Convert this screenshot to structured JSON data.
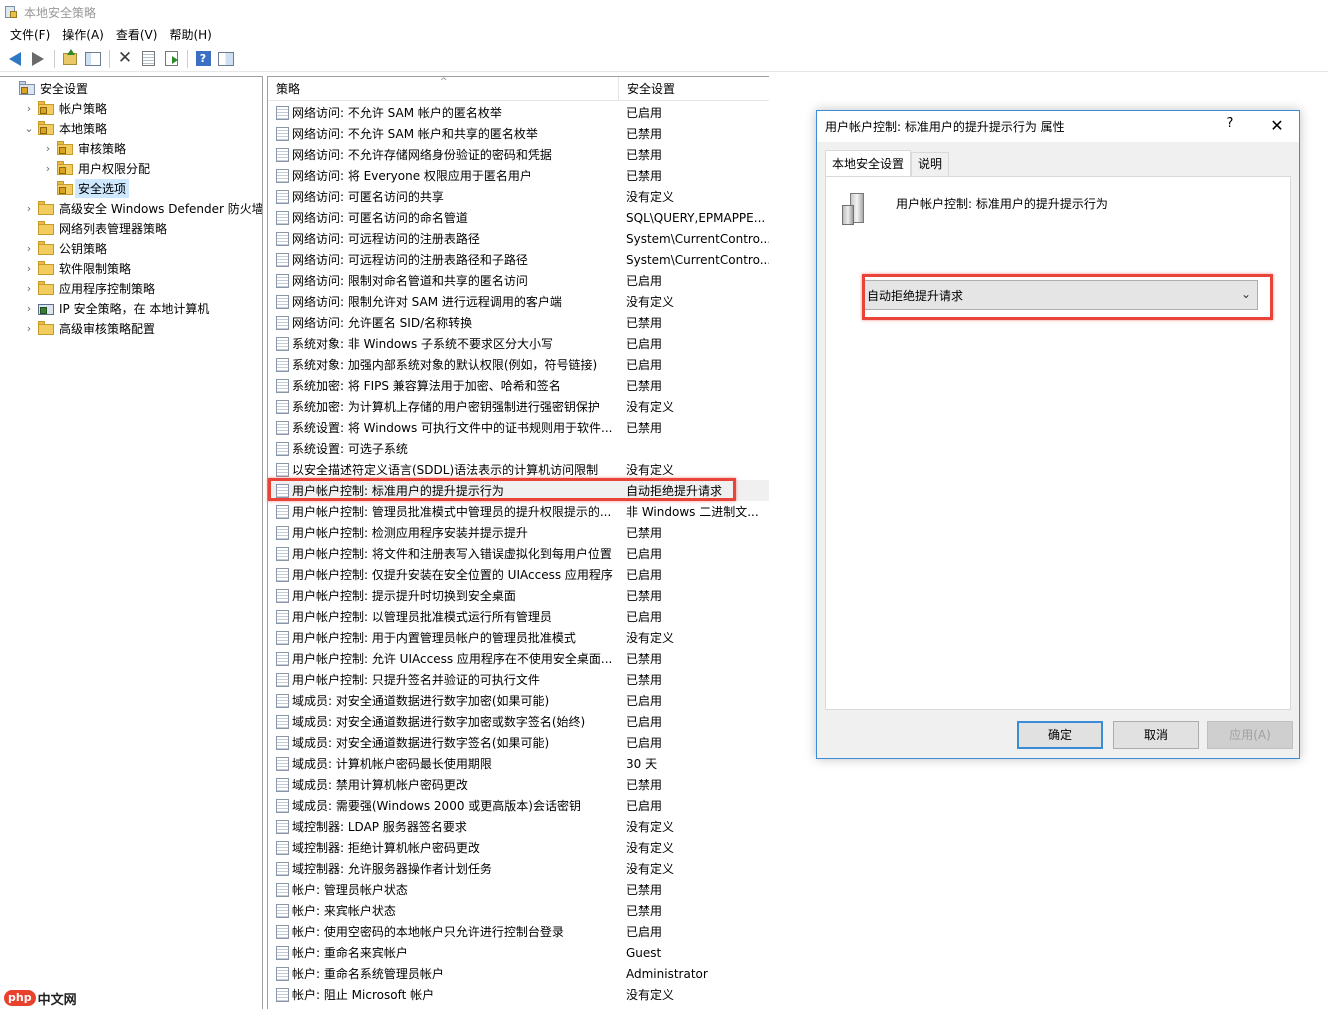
{
  "window": {
    "title": "本地安全策略"
  },
  "menu": [
    "文件(F)",
    "操作(A)",
    "查看(V)",
    "帮助(H)"
  ],
  "toolbar": [
    "back-icon",
    "forward-icon",
    "up-folder-icon",
    "show-tree-icon",
    "delete-icon",
    "properties-icon",
    "export-list-icon",
    "help-icon",
    "action-pane-icon"
  ],
  "tree": [
    {
      "label": "安全设置",
      "expander": "",
      "depth": 0,
      "folder": "root"
    },
    {
      "label": "帐户策略",
      "expander": "›",
      "depth": 1,
      "folder": "lock"
    },
    {
      "label": "本地策略",
      "expander": "⌄",
      "depth": 1,
      "folder": "lock"
    },
    {
      "label": "审核策略",
      "expander": "›",
      "depth": 2,
      "folder": "lock"
    },
    {
      "label": "用户权限分配",
      "expander": "›",
      "depth": 2,
      "folder": "lock"
    },
    {
      "label": "安全选项",
      "expander": "",
      "depth": 2,
      "folder": "lock",
      "selected": true
    },
    {
      "label": "高级安全 Windows Defender 防火墙",
      "expander": "›",
      "depth": 1,
      "folder": "plain"
    },
    {
      "label": "网络列表管理器策略",
      "expander": "",
      "depth": 1,
      "folder": "plain"
    },
    {
      "label": "公钥策略",
      "expander": "›",
      "depth": 1,
      "folder": "plain"
    },
    {
      "label": "软件限制策略",
      "expander": "›",
      "depth": 1,
      "folder": "plain"
    },
    {
      "label": "应用程序控制策略",
      "expander": "›",
      "depth": 1,
      "folder": "plain"
    },
    {
      "label": "IP 安全策略，在 本地计算机",
      "expander": "›",
      "depth": 1,
      "folder": "ip"
    },
    {
      "label": "高级审核策略配置",
      "expander": "›",
      "depth": 1,
      "folder": "plain"
    }
  ],
  "list": {
    "col_policy": "策略",
    "col_setting": "安全设置",
    "rows": [
      {
        "policy": "网络访问: 不允许 SAM 帐户的匿名枚举",
        "setting": "已启用"
      },
      {
        "policy": "网络访问: 不允许 SAM 帐户和共享的匿名枚举",
        "setting": "已禁用"
      },
      {
        "policy": "网络访问: 不允许存储网络身份验证的密码和凭据",
        "setting": "已禁用"
      },
      {
        "policy": "网络访问: 将 Everyone 权限应用于匿名用户",
        "setting": "已禁用"
      },
      {
        "policy": "网络访问: 可匿名访问的共享",
        "setting": "没有定义"
      },
      {
        "policy": "网络访问: 可匿名访问的命名管道",
        "setting": "SQL\\QUERY,EPMAPPE..."
      },
      {
        "policy": "网络访问: 可远程访问的注册表路径",
        "setting": "System\\CurrentContro..."
      },
      {
        "policy": "网络访问: 可远程访问的注册表路径和子路径",
        "setting": "System\\CurrentContro..."
      },
      {
        "policy": "网络访问: 限制对命名管道和共享的匿名访问",
        "setting": "已启用"
      },
      {
        "policy": "网络访问: 限制允许对 SAM 进行远程调用的客户端",
        "setting": "没有定义"
      },
      {
        "policy": "网络访问: 允许匿名 SID/名称转换",
        "setting": "已禁用"
      },
      {
        "policy": "系统对象: 非 Windows 子系统不要求区分大小写",
        "setting": "已启用"
      },
      {
        "policy": "系统对象: 加强内部系统对象的默认权限(例如，符号链接)",
        "setting": "已启用"
      },
      {
        "policy": "系统加密: 将 FIPS 兼容算法用于加密、哈希和签名",
        "setting": "已禁用"
      },
      {
        "policy": "系统加密: 为计算机上存储的用户密钥强制进行强密钥保护",
        "setting": "没有定义"
      },
      {
        "policy": "系统设置: 将 Windows 可执行文件中的证书规则用于软件...",
        "setting": "已禁用"
      },
      {
        "policy": "系统设置: 可选子系统",
        "setting": ""
      },
      {
        "policy": "以安全描述符定义语言(SDDL)语法表示的计算机访问限制",
        "setting": "没有定义"
      },
      {
        "policy": "用户帐户控制: 标准用户的提升提示行为",
        "setting": "自动拒绝提升请求",
        "active": true
      },
      {
        "policy": "用户帐户控制: 管理员批准模式中管理员的提升权限提示的...",
        "setting": "非 Windows 二进制文..."
      },
      {
        "policy": "用户帐户控制: 检测应用程序安装并提示提升",
        "setting": "已禁用"
      },
      {
        "policy": "用户帐户控制: 将文件和注册表写入错误虚拟化到每用户位置",
        "setting": "已启用"
      },
      {
        "policy": "用户帐户控制: 仅提升安装在安全位置的 UIAccess 应用程序",
        "setting": "已启用"
      },
      {
        "policy": "用户帐户控制: 提示提升时切换到安全桌面",
        "setting": "已禁用"
      },
      {
        "policy": "用户帐户控制: 以管理员批准模式运行所有管理员",
        "setting": "已启用"
      },
      {
        "policy": "用户帐户控制: 用于内置管理员帐户的管理员批准模式",
        "setting": "没有定义"
      },
      {
        "policy": "用户帐户控制: 允许 UIAccess 应用程序在不使用安全桌面...",
        "setting": "已禁用"
      },
      {
        "policy": "用户帐户控制: 只提升签名并验证的可执行文件",
        "setting": "已禁用"
      },
      {
        "policy": "域成员: 对安全通道数据进行数字加密(如果可能)",
        "setting": "已启用"
      },
      {
        "policy": "域成员: 对安全通道数据进行数字加密或数字签名(始终)",
        "setting": "已启用"
      },
      {
        "policy": "域成员: 对安全通道数据进行数字签名(如果可能)",
        "setting": "已启用"
      },
      {
        "policy": "域成员: 计算机帐户密码最长使用期限",
        "setting": "30 天"
      },
      {
        "policy": "域成员: 禁用计算机帐户密码更改",
        "setting": "已禁用"
      },
      {
        "policy": "域成员: 需要强(Windows 2000 或更高版本)会话密钥",
        "setting": "已启用"
      },
      {
        "policy": "域控制器: LDAP 服务器签名要求",
        "setting": "没有定义"
      },
      {
        "policy": "域控制器: 拒绝计算机帐户密码更改",
        "setting": "没有定义"
      },
      {
        "policy": "域控制器: 允许服务器操作者计划任务",
        "setting": "没有定义"
      },
      {
        "policy": "帐户: 管理员帐户状态",
        "setting": "已禁用"
      },
      {
        "policy": "帐户: 来宾帐户状态",
        "setting": "已禁用"
      },
      {
        "policy": "帐户: 使用空密码的本地帐户只允许进行控制台登录",
        "setting": "已启用"
      },
      {
        "policy": "帐户: 重命名来宾帐户",
        "setting": "Guest"
      },
      {
        "policy": "帐户: 重命名系统管理员帐户",
        "setting": "Administrator"
      },
      {
        "policy": "帐户: 阻止 Microsoft 帐户",
        "setting": "没有定义"
      }
    ]
  },
  "dialog": {
    "title": "用户帐户控制: 标准用户的提升提示行为 属性",
    "help": "?",
    "close": "✕",
    "tabs": [
      "本地安全设置",
      "说明"
    ],
    "policy_name": "用户帐户控制: 标准用户的提升提示行为",
    "selected_value": "自动拒绝提升请求",
    "ok": "确定",
    "cancel": "取消",
    "apply": "应用(A)"
  },
  "watermark": {
    "logo": "php",
    "text": "中文网"
  },
  "colors": {
    "highlight": "#e8443a",
    "accent": "#3b8cd7",
    "selection": "#cde8ff"
  }
}
